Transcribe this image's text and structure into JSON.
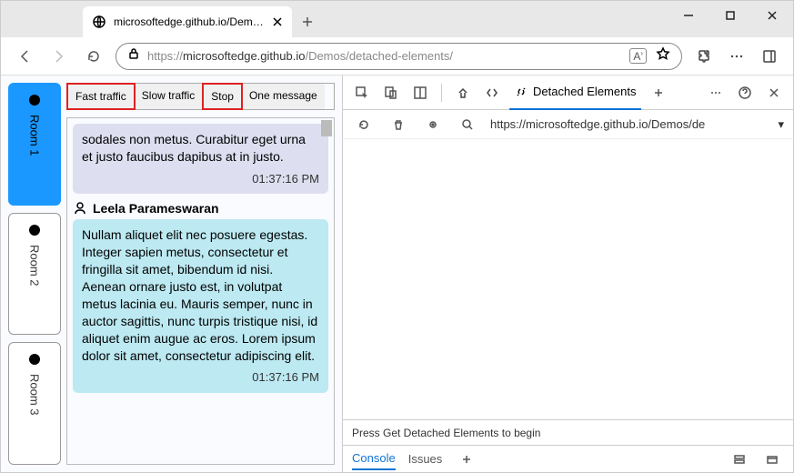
{
  "browser": {
    "tab_title": "microsoftedge.github.io/Demos/c",
    "url_prefix": "https://",
    "url_host": "microsoftedge.github.io",
    "url_path": "/Demos/detached-elements/"
  },
  "rooms": [
    {
      "label": "Room 1",
      "active": true
    },
    {
      "label": "Room 2",
      "active": false
    },
    {
      "label": "Room 3",
      "active": false
    }
  ],
  "traffic_buttons": [
    {
      "label": "Fast traffic",
      "highlight": true
    },
    {
      "label": "Slow traffic",
      "highlight": false
    },
    {
      "label": "Stop",
      "highlight": true
    },
    {
      "label": "One message",
      "highlight": false
    }
  ],
  "messages": [
    {
      "author": "",
      "body": "sodales non metus. Curabitur eget urna et justo faucibus dapibus at in justo.",
      "time": "01:37:16 PM",
      "color": "purple"
    },
    {
      "author": "Leela Parameswaran",
      "body": "Nullam aliquet elit nec posuere egestas. Integer sapien metus, consectetur et fringilla sit amet, bibendum id nisi. Aenean ornare justo est, in volutpat metus lacinia eu. Mauris semper, nunc in auctor sagittis, nunc turpis tristique nisi, id aliquet enim augue ac eros. Lorem ipsum dolor sit amet, consectetur adipiscing elit.",
      "time": "01:37:16 PM",
      "color": "cyan"
    }
  ],
  "devtools": {
    "active_tab": "Detached Elements",
    "toolbar_url": "https://microsoftedge.github.io/Demos/de",
    "status": "Press Get Detached Elements to begin",
    "drawer": {
      "console": "Console",
      "issues": "Issues"
    }
  }
}
